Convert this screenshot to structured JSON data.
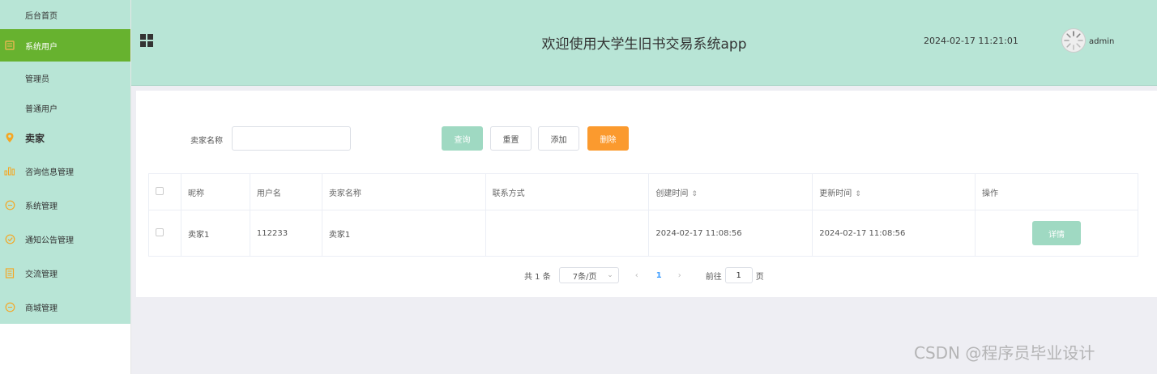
{
  "sidebar": {
    "items": [
      {
        "label": "后台首页",
        "icon": "home-icon"
      },
      {
        "label": "系统用户",
        "icon": "user-icon",
        "active": true
      },
      {
        "label": "管理员"
      },
      {
        "label": "普通用户"
      },
      {
        "label": "卖家",
        "icon": "location-icon"
      },
      {
        "label": "咨询信息管理",
        "icon": "bar-chart-icon"
      },
      {
        "label": "系统管理",
        "icon": "chat-icon"
      },
      {
        "label": "通知公告管理",
        "icon": "check-circle-icon"
      },
      {
        "label": "交流管理",
        "icon": "document-icon"
      },
      {
        "label": "商城管理",
        "icon": "chat-icon"
      }
    ]
  },
  "header": {
    "title": "欢迎使用大学生旧书交易系统app",
    "datetime": "2024-02-17 11:21:01",
    "username": "admin"
  },
  "search": {
    "label": "卖家名称",
    "value": "",
    "buttons": {
      "query": "查询",
      "reset": "重置",
      "add": "添加",
      "delete": "删除"
    }
  },
  "table": {
    "headers": [
      "昵称",
      "用户名",
      "卖家名称",
      "联系方式",
      "创建时间",
      "更新时间",
      "操作"
    ],
    "rows": [
      {
        "nickname": "卖家1",
        "username": "112233",
        "seller": "卖家1",
        "contact": "",
        "created": "2024-02-17 11:08:56",
        "updated": "2024-02-17 11:08:56",
        "action": "详情"
      }
    ]
  },
  "pagination": {
    "total": "共 1 条",
    "page_size": "7条/页",
    "prev": "‹",
    "current": "1",
    "next": "›",
    "goto": "前往",
    "goto_value": "1",
    "goto_suffix": "页"
  },
  "watermark": "CSDN @程序员毕业设计",
  "colors": {
    "accent": "#67b22f",
    "header_bg": "#b8e5d6",
    "delete": "#fb9a2e",
    "query": "#9fd9c2",
    "icon": "#f5a623"
  }
}
